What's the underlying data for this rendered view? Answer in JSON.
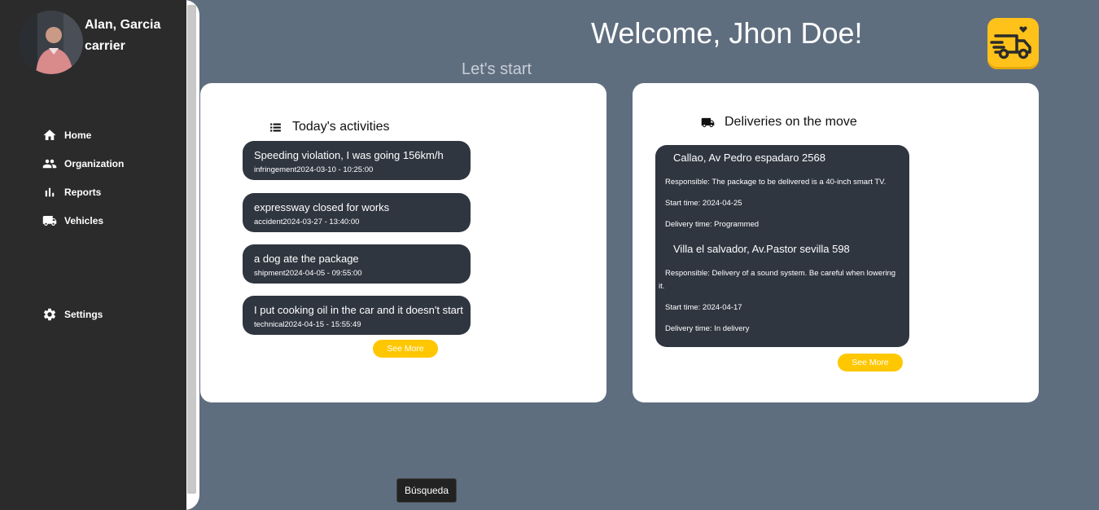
{
  "user": {
    "name": "Alan, Garcia",
    "role": "carrier"
  },
  "nav": [
    {
      "label": "Home",
      "icon": "home-icon"
    },
    {
      "label": "Organization",
      "icon": "group-icon"
    },
    {
      "label": "Reports",
      "icon": "bar-chart-icon"
    },
    {
      "label": "Vehicles",
      "icon": "truck-icon"
    },
    {
      "label": "Settings",
      "icon": "gear-icon"
    }
  ],
  "header": {
    "welcome": "Welcome, Jhon Doe!",
    "subtitle": "Let's start"
  },
  "activities": {
    "title": "Today's activities",
    "items": [
      {
        "description": "Speeding violation, I was going 156km/h",
        "meta": "infringement2024-03-10 - 10:25:00"
      },
      {
        "description": "expressway closed for works",
        "meta": "accident2024-03-27 - 13:40:00"
      },
      {
        "description": "a dog ate the package",
        "meta": "shipment2024-04-05 - 09:55:00"
      },
      {
        "description": "I put cooking oil in the car and it doesn't start",
        "meta": "technical2024-04-15 - 15:55:49"
      }
    ],
    "see_more": "See More"
  },
  "deliveries": {
    "title": "Deliveries on the move",
    "items": [
      {
        "address": "Callao, Av Pedro espadaro 2568",
        "responsible": "Responsible: The package to be delivered is a 40-inch smart TV.",
        "start": "Start time: 2024-04-25",
        "delivery": "Delivery time: Programmed"
      },
      {
        "address": "Villa el salvador, Av.Pastor sevilla 598",
        "responsible": "Responsible: Delivery of a sound system. Be careful when lowering it.",
        "start": "Start time: 2024-04-17",
        "delivery": "Delivery time: In delivery"
      }
    ],
    "see_more": "See More"
  },
  "tooltip": "Búsqueda",
  "colors": {
    "background": "#5f6e7f",
    "sidebar": "#2b2b2b",
    "accent": "#ffc700",
    "item_bg": "#2f3640"
  }
}
